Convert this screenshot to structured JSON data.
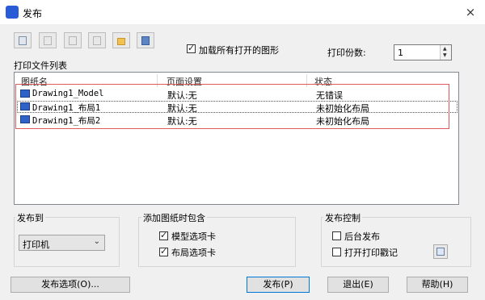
{
  "window": {
    "title": "发布",
    "close_icon": "×",
    "app_icon": "publish-app-icon"
  },
  "toolbar": {
    "buttons": [
      {
        "name": "add-sheet-button",
        "icon": "add-sheet-icon",
        "enabled": true
      },
      {
        "name": "remove-sheet-button",
        "icon": "remove-sheet-icon",
        "enabled": false
      },
      {
        "name": "move-up-button",
        "icon": "move-up-icon",
        "enabled": false
      },
      {
        "name": "move-down-button",
        "icon": "move-down-icon",
        "enabled": false
      },
      {
        "name": "load-list-button",
        "icon": "folder-icon",
        "enabled": true
      },
      {
        "name": "save-list-button",
        "icon": "save-icon",
        "enabled": true
      }
    ],
    "load_all_label": "加载所有打开的图形",
    "load_all_checked": true,
    "copies_label": "打印份数:",
    "copies_value": "1"
  },
  "file_list": {
    "group_label": "打印文件列表",
    "columns": [
      "图纸名",
      "页面设置",
      "状态"
    ],
    "rows": [
      {
        "name": "Drawing1_Model",
        "setup": "默认:无",
        "status": "无错误"
      },
      {
        "name": "Drawing1_布局1",
        "setup": "默认:无",
        "status": "未初始化布局"
      },
      {
        "name": "Drawing1_布局2",
        "setup": "默认:无",
        "status": "未初始化布局"
      }
    ],
    "highlight_color": "#e05a5a"
  },
  "publish_to": {
    "label": "发布到",
    "selected": "打印机"
  },
  "include": {
    "label": "添加图纸时包含",
    "model_tab_label": "模型选项卡",
    "model_tab_checked": true,
    "layout_tab_label": "布局选项卡",
    "layout_tab_checked": true
  },
  "control": {
    "label": "发布控制",
    "background_label": "后台发布",
    "background_checked": false,
    "stamp_label": "打开打印戳记",
    "stamp_checked": false
  },
  "buttons": {
    "options": "发布选项(O)...",
    "publish": "发布(P)",
    "exit": "退出(E)",
    "help": "帮助(H)"
  }
}
